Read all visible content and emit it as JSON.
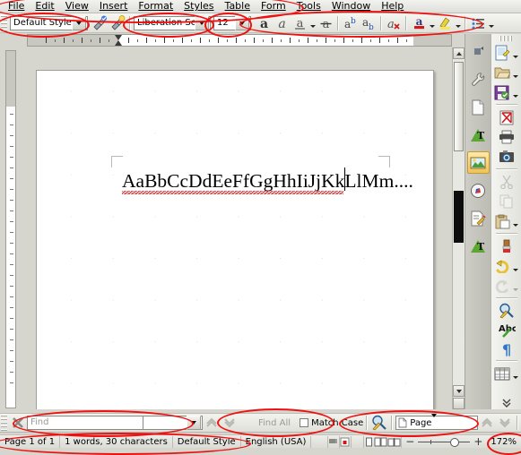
{
  "app": {
    "name": "LibreOffice Writer"
  },
  "menubar": {
    "items": [
      {
        "label": "File"
      },
      {
        "label": "Edit"
      },
      {
        "label": "View"
      },
      {
        "label": "Insert"
      },
      {
        "label": "Format"
      },
      {
        "label": "Styles"
      },
      {
        "label": "Table"
      },
      {
        "label": "Form"
      },
      {
        "label": "Tools"
      },
      {
        "label": "Window"
      },
      {
        "label": "Help"
      }
    ]
  },
  "formatting_toolbar": {
    "paragraph_style": {
      "value": "Default Style",
      "icon": "chevron-down-icon"
    },
    "update_style_icon": "update-selected-style-icon",
    "new_style_icon": "new-style-from-selection-icon",
    "font_name": {
      "value": "Liberation Serif",
      "icon": "chevron-down-icon"
    },
    "font_size": {
      "value": "12",
      "icon": "chevron-down-icon"
    },
    "buttons": [
      {
        "name": "bold-button",
        "label": "a",
        "tip": "Bold"
      },
      {
        "name": "italic-button",
        "label": "a",
        "tip": "Italic"
      },
      {
        "name": "underline-button",
        "label": "a",
        "tip": "Underline"
      },
      {
        "name": "strikethrough-button",
        "label": "a",
        "tip": "Strikethrough"
      },
      {
        "name": "superscript-button",
        "label": "ab",
        "tip": "Superscript"
      },
      {
        "name": "subscript-button",
        "label": "ab",
        "tip": "Subscript"
      },
      {
        "name": "clear-formatting-button",
        "label": "a",
        "tip": "Clear Direct Formatting"
      },
      {
        "name": "font-color-button",
        "label": "a",
        "tip": "Font Color"
      },
      {
        "name": "highlight-color-button",
        "label": "",
        "tip": "Highlighting Color"
      },
      {
        "name": "unordered-list-button",
        "label": "",
        "tip": "Unordered List"
      }
    ]
  },
  "document": {
    "text": "AaBbCcDdEeFfGgHhIiJjKkLlMm....",
    "spellcheck_underline": true,
    "cursor_visible": true,
    "grid_visible": true
  },
  "sidebar": {
    "tabs": [
      {
        "name": "sidebar-settings-icon",
        "label": "Sidebar Settings"
      },
      {
        "name": "properties-icon",
        "label": "Properties"
      },
      {
        "name": "page-icon",
        "label": "Page"
      },
      {
        "name": "styles-icon",
        "label": "Styles"
      },
      {
        "name": "gallery-icon",
        "label": "Gallery",
        "selected": true
      },
      {
        "name": "navigator-icon",
        "label": "Navigator"
      },
      {
        "name": "manage-changes-icon",
        "label": "Manage Changes"
      },
      {
        "name": "style-inspector-icon",
        "label": "Style Inspector"
      }
    ]
  },
  "standard_toolbar": {
    "buttons": [
      {
        "name": "new-document-button",
        "label": "New",
        "dropdown": true
      },
      {
        "name": "open-file-button",
        "label": "Open",
        "dropdown": true
      },
      {
        "name": "save-button",
        "label": "Save",
        "dropdown": true
      },
      {
        "name": "export-pdf-button",
        "label": "Export as PDF"
      },
      {
        "name": "print-button",
        "label": "Print"
      },
      {
        "name": "print-preview-button",
        "label": "Toggle Print Preview"
      },
      {
        "name": "cut-button",
        "label": "Cut",
        "disabled": true
      },
      {
        "name": "copy-button",
        "label": "Copy",
        "disabled": true
      },
      {
        "name": "paste-button",
        "label": "Paste",
        "dropdown": true
      },
      {
        "name": "clone-formatting-button",
        "label": "Clone Formatting"
      },
      {
        "name": "undo-button",
        "label": "Undo",
        "dropdown": true
      },
      {
        "name": "redo-button",
        "label": "Redo",
        "dropdown": true,
        "disabled": true
      },
      {
        "name": "find-replace-button",
        "label": "Find and Replace"
      },
      {
        "name": "spelling-button",
        "label": "Check Spelling"
      },
      {
        "name": "formatting-marks-button",
        "label": "Formatting Marks"
      },
      {
        "name": "insert-table-button",
        "label": "Insert Table",
        "dropdown": true
      }
    ],
    "overflow_label": "More Buttons"
  },
  "find_toolbar": {
    "close_label": "Close Find Bar",
    "search_placeholder": "Find",
    "find_prev_label": "Find Previous",
    "find_next_label": "Find Next",
    "find_all_label": "Find All",
    "match_case_label": "Match Case",
    "match_case_checked": false,
    "find_replace_label": "Find and Replace",
    "navigation_value": "Page",
    "nav_prev_label": "Previous Page",
    "nav_next_label": "Next Page"
  },
  "statusbar": {
    "page": "Page 1 of 1",
    "words": "1 words, 30 characters",
    "style": "Default Style",
    "language": "English (USA)",
    "selection_mode_label": "Selection Mode",
    "save_state_label": "Unsaved modifications",
    "view_single_label": "Single-page view",
    "view_multi_label": "Multiple-page view",
    "view_book_label": "Book view",
    "zoom_out_label": "Zoom Out",
    "zoom_in_label": "Zoom In",
    "zoom": "172%"
  },
  "colors": {
    "accent_red": "#ee1111",
    "toolbar_bg": "#e9e9e3",
    "desk_bg": "#d6d6ce",
    "page_bg": "#ffffff",
    "spell_underline": "#e02020",
    "selected_tab": "#f0c15a"
  }
}
